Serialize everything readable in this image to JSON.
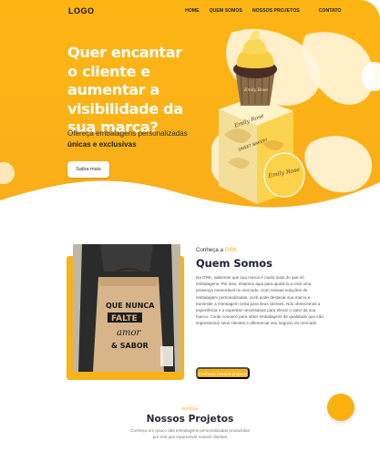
{
  "nav": {
    "logo": "LOGO",
    "links": [
      "HOME",
      "QUEM SOMOS",
      "NOSSOS PROJETOS",
      "CONTATO"
    ]
  },
  "hero": {
    "headline": "Quer encantar o cliente e aumentar a visibilidade da sua marca?",
    "subhead": "Ofereça embalagens personalizadas",
    "subhead_bold": "únicas e exclusivas",
    "cta": "Saiba mais",
    "product_labels": [
      "Emily Rose",
      "SWEET BAKERY",
      "Emily Rose"
    ]
  },
  "about": {
    "kicker_prefix": "Conheça a ",
    "kicker_brand": "GRK",
    "title": "Quem Somos",
    "text": "Na GRK, sabemos que sua marca é muito mais do que só embalagens. Por isso, estamos aqui para ajudá-lo a criar uma presença memorável no mercado. Com nossas soluções de embalagem personalizadas, você pode destacar sua marca e transmitir a mensagem certa para seus clientes. Nós oferecemos a experiência e a expertise necessárias para elevar o valor da sua marca. Conte conosco para obter embalagens de qualidade que irão impressionar seus clientes e diferenciar seu negócio do mercado",
    "cta": "Conheça nossos projetos",
    "bag_lines": [
      "QUE NUNCA",
      "FALTE",
      "amor",
      "& SABOR"
    ]
  },
  "projects": {
    "kicker": "Portfolio",
    "title": "Nossos Projetos",
    "text": "Conheça um pouco das embalagens personalizadas produzidas por nós que surpreende nossos clientes"
  },
  "colors": {
    "accent": "#f6b41a",
    "hero": "#fdb514",
    "dark": "#1d1d3a"
  }
}
